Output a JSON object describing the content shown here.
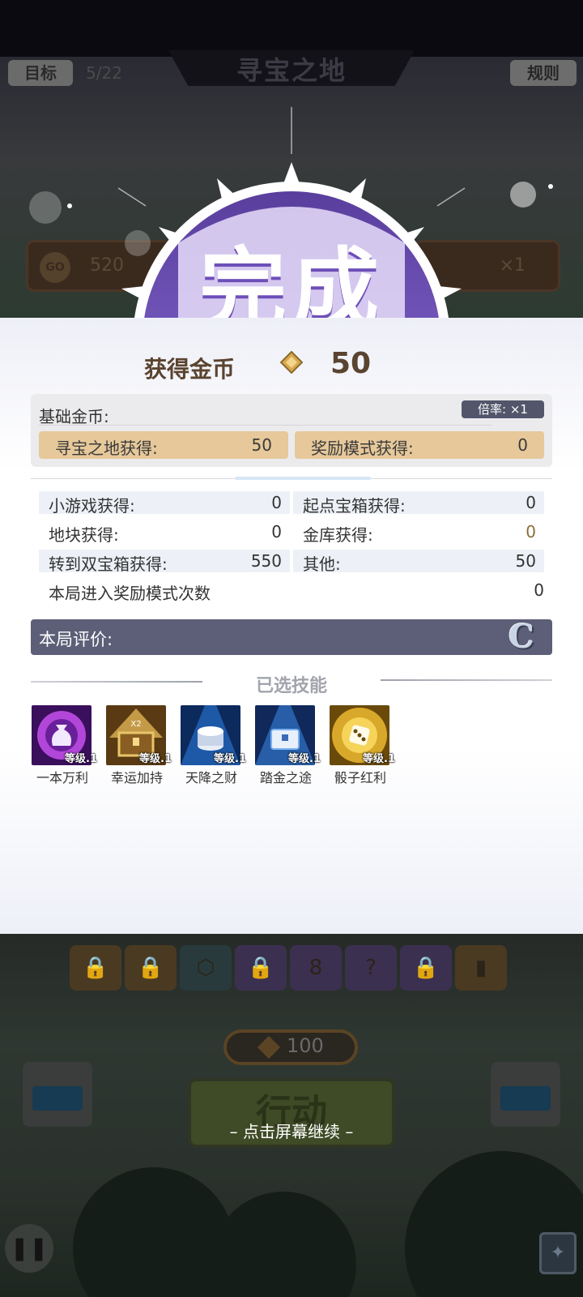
{
  "top_bar": {
    "goal_label": "目标",
    "goal_progress": "5/22",
    "title": "寻宝之地",
    "rules_label": "规则"
  },
  "background_hud": {
    "coin_badge": "GO",
    "coin_value": "520",
    "multiplier_value": "×1"
  },
  "badge": {
    "title": "完成"
  },
  "earnings": {
    "label": "获得金币",
    "value": "50"
  },
  "base_coins": {
    "title": "基础金币:",
    "rate": "倍率: ×1",
    "cells": [
      {
        "label": "寻宝之地获得:",
        "value": "50"
      },
      {
        "label": "奖励模式获得:",
        "value": "0"
      }
    ]
  },
  "stats": [
    {
      "label": "小游戏获得:",
      "value": "0"
    },
    {
      "label": "起点宝箱获得:",
      "value": "0"
    },
    {
      "label": "地块获得:",
      "value": "0"
    },
    {
      "label": "金库获得:",
      "value": "0"
    },
    {
      "label": "转到双宝箱获得:",
      "value": "550"
    },
    {
      "label": "其他:",
      "value": "50"
    }
  ],
  "reward_mode_entries": {
    "label": "本局进入奖励模式次数",
    "value": "0"
  },
  "evaluation": {
    "label": "本局评价:",
    "grade": "C"
  },
  "skills": {
    "title": "已选技能",
    "items": [
      {
        "name": "一本万利",
        "level": "等级.1",
        "icon": "money-bag-icon"
      },
      {
        "name": "幸运加持",
        "level": "等级.1",
        "icon": "treasure-chest-x2-icon"
      },
      {
        "name": "天降之财",
        "level": "等级.1",
        "icon": "coin-stack-icon"
      },
      {
        "name": "踏金之途",
        "level": "等级.1",
        "icon": "chest-path-icon"
      },
      {
        "name": "骰子红利",
        "level": "等级.1",
        "icon": "dice-coin-icon"
      }
    ]
  },
  "board": {
    "tile_number": "8",
    "cost_value": "100",
    "action_label": "行动",
    "continue_hint": "– 点击屏幕继续 –"
  },
  "colors": {
    "panel_bg": "#ffffff",
    "gold_cell": "#e6c89a",
    "eval_bar": "#5c5f77",
    "badge_purple": "#7b5cc8",
    "earn_text": "#5a4430"
  }
}
